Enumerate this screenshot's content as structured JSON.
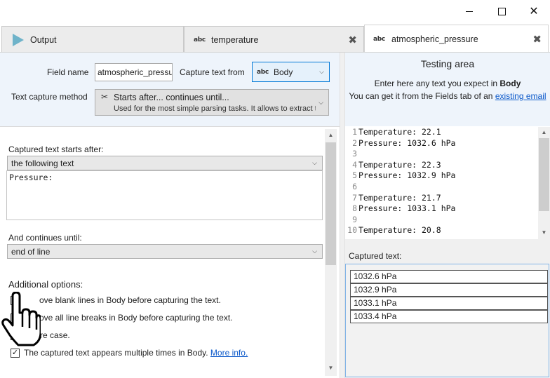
{
  "tabs": [
    {
      "label": "Output",
      "icon": "play-icon"
    },
    {
      "label": "temperature",
      "icon": "abc-icon",
      "close": "✖"
    },
    {
      "label": "atmospheric_pressure",
      "icon": "abc-icon",
      "close": "✖"
    }
  ],
  "tab_icon_text": "abc",
  "form": {
    "field_name_label": "Field name",
    "field_name_value": "atmospheric_pressure",
    "capture_from_label": "Capture text from",
    "capture_from_value": "Body",
    "method_label": "Text capture method",
    "method_title": "Starts after... continues until...",
    "method_desc": "Used for the most simple parsing tasks. It allows to extract the text"
  },
  "capture": {
    "starts_after_label": "Captured text starts after:",
    "starts_after_value": "the following text",
    "starts_after_text": "Pressure:",
    "continues_until_label": "And continues until:",
    "continues_until_value": "end of line",
    "additional_label": "Additional options:",
    "options": [
      {
        "label": "Remove blank lines in Body before capturing the text.",
        "visible_label": "ove blank lines in Body before capturing the text.",
        "checked": false
      },
      {
        "label": "Remove all line breaks in Body before capturing the text.",
        "visible_label": "ove all line breaks in Body before capturing the text.",
        "checked": false
      },
      {
        "label": "Ignore case.",
        "visible_label": "gnore case.",
        "checked": false
      },
      {
        "label": "The captured text appears multiple times in Body.",
        "visible_label": "The captured text appears multiple times in Body.",
        "checked": true
      }
    ],
    "more_info": "More info.",
    "check_mark": "✓"
  },
  "testing": {
    "title": "Testing area",
    "line1_prefix": "Enter here any text you expect in ",
    "line1_bold": "Body",
    "line2_prefix": "You can get it from the Fields tab of an ",
    "line2_link": "existing email",
    "code_lines": [
      {
        "n": "1",
        "text": "Temperature: 22.1"
      },
      {
        "n": "2",
        "text": "Pressure: 1032.6 hPa"
      },
      {
        "n": "3",
        "text": ""
      },
      {
        "n": "4",
        "text": "Temperature: 22.3"
      },
      {
        "n": "5",
        "text": "Pressure: 1032.9 hPa"
      },
      {
        "n": "6",
        "text": ""
      },
      {
        "n": "7",
        "text": "Temperature: 21.7"
      },
      {
        "n": "8",
        "text": "Pressure: 1033.1 hPa"
      },
      {
        "n": "9",
        "text": ""
      },
      {
        "n": "10",
        "text": "Temperature: 20.8"
      }
    ],
    "captured_label": "Captured text:",
    "captured": [
      "1032.6 hPa",
      "1032.9 hPa",
      "1033.1 hPa",
      "1033.4 hPa"
    ]
  },
  "window": {
    "close_glyph": "✕"
  },
  "colors": {
    "accent": "#0078d7",
    "panel": "#eef4fb",
    "link": "#0a58ca"
  }
}
